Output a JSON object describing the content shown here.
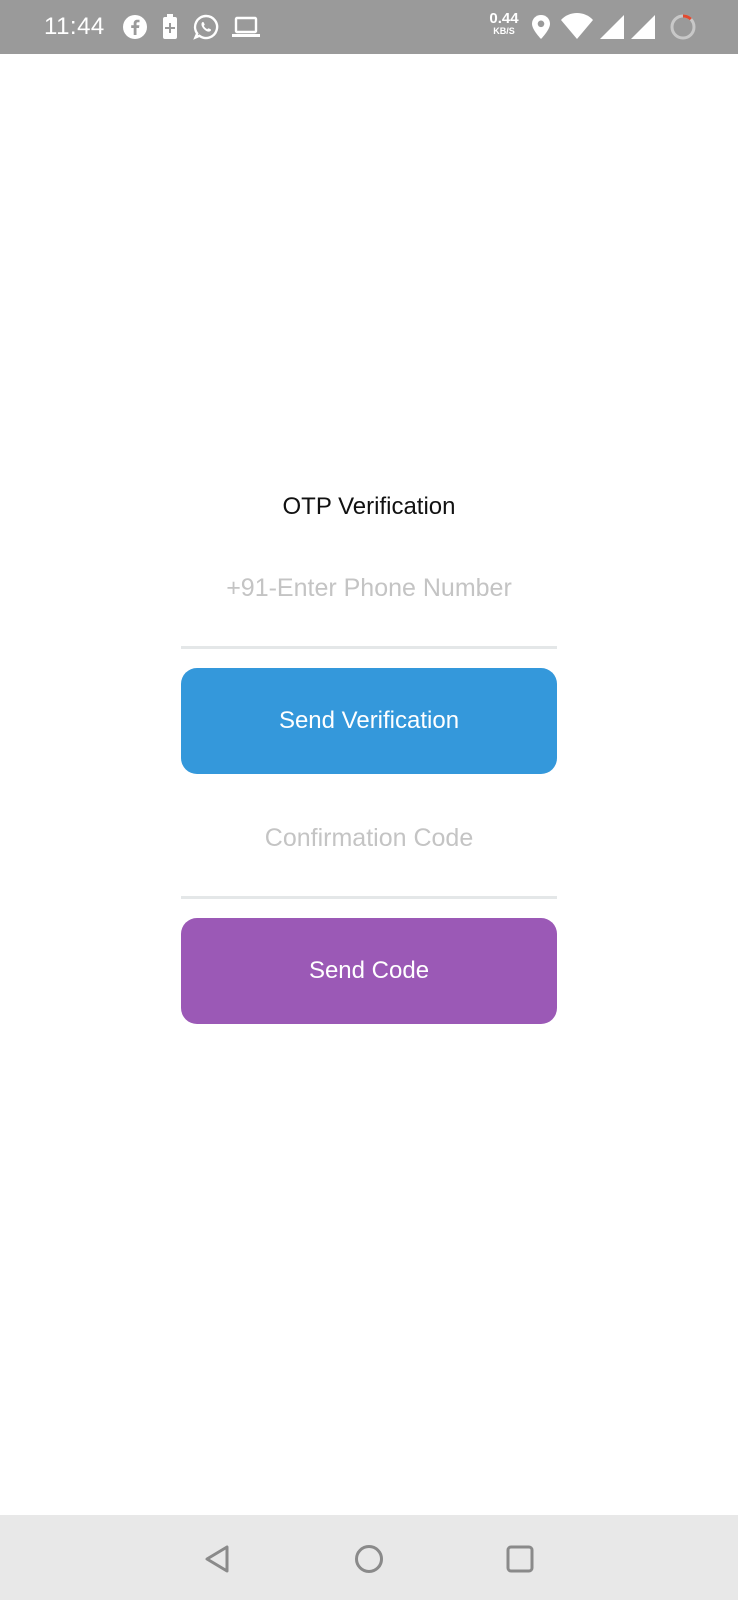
{
  "status_bar": {
    "time": "11:44",
    "net_speed_value": "0.44",
    "net_speed_unit": "KB/S",
    "icons": [
      "facebook-icon",
      "battery-saver-icon",
      "whatsapp-icon",
      "laptop-icon",
      "location-icon",
      "wifi-icon",
      "signal-icon",
      "signal-icon",
      "loading-ring-icon"
    ]
  },
  "screen": {
    "title": "OTP Verification",
    "phone_placeholder": "+91-Enter Phone Number",
    "phone_value": "",
    "send_verification_label": "Send Verification",
    "code_placeholder": "Confirmation Code",
    "code_value": "",
    "send_code_label": "Send Code"
  },
  "colors": {
    "status_bar_bg": "#9a9a9a",
    "send_verification_bg": "#3498db",
    "send_code_bg": "#9b59b6",
    "nav_bar_bg": "#e8e8e8",
    "placeholder_text": "#c4c4c4",
    "underline": "#e4e7e8"
  },
  "nav_bar": {
    "buttons": [
      "back-icon",
      "home-icon",
      "recents-icon"
    ]
  }
}
